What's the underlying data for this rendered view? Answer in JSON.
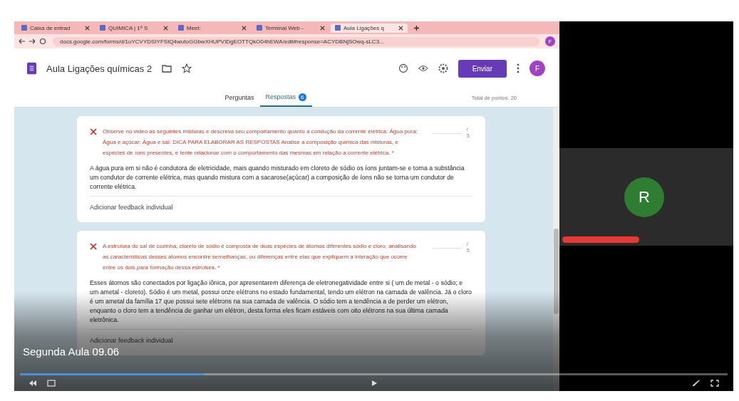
{
  "browser": {
    "tabs": [
      {
        "label": "Caixa de entrad",
        "selected": false
      },
      {
        "label": "QUIMICA | 1º S",
        "selected": false
      },
      {
        "label": "Meet: ",
        "selected": false
      },
      {
        "label": "Terminal Web -",
        "selected": false
      },
      {
        "label": "Aula Ligações q",
        "selected": true
      }
    ],
    "url": "docs.google.com/forms/d/1uYCVYDSIYFStQ4wutoGGbwXHUPVIDgEOTTQkO04hEWA/edit#response=ACYDBNjSOwq-sLC3...",
    "profile": "F"
  },
  "form": {
    "title": "Aula Ligações químicas 2",
    "send_button": "Enviar",
    "avatar": "F",
    "tabs": [
      {
        "label": "Perguntas",
        "selected": false
      },
      {
        "label": "Respostas",
        "selected": true,
        "badge": "6"
      }
    ],
    "total_points": "Total de pontos: 20",
    "questions": [
      {
        "correct": false,
        "text": "Observe no vídeo as seguintes misturas e descreva seu comportamento quanto a condução da corrente elétrica: Água pura: Água e açúcar: Água e sal: DICA PARA ELABORAR AS RESPOSTAS Analise a composição química das misturas, e espécies de íons presentes, e tente relacionar com o comportamento das mesmas em relação a corrente elétrica. *",
        "score": "/ 5",
        "answer": "A água pura em si não é condutora de eletricidade, mais quando misturado em cloreto de sódio os íons juntam-se e torna a substância um condutor de corrente elétrica, mas quando mistura com a sacarose(açúcar) a composição de íons não se torna um condutor de corrente elétrica.",
        "feedback": "Adicionar feedback individual"
      },
      {
        "correct": false,
        "text": "A estrutura do sal de cozinha, cloreto de sódio é composta de duas espécies de átomos diferentes sódio e cloro, analisando as características desses átomos encontre semelhanças, ou diferenças entre elas que expliquem a interação que ocorre entre os dois para formação dessa estrutura. *",
        "score": "/ 5",
        "answer": "Esses átomos são conectados por ligação iônica, por apresentarem diferença de eletronegatividade entre si ( um de metal - o sódio; e um ametal - cloreto). Sódio é um metal, possui onze elétrons no estado fundamental, tendo um elétron na camada de valência. Já o cloro é um ametal da família 17 que possui sete elétrons na sua camada de valência. O sódio tem a tendência a de perder um elétron, enquanto o cloro tem a tendência de ganhar um elétron, desta forma eles ficam estáveis com oito elétrons na sua última camada eletrônica.",
        "feedback": "Adicionar feedback individual"
      }
    ]
  },
  "participant": {
    "initial": "R"
  },
  "video": {
    "title": "Segunda Aula 09.06",
    "level": 0.26
  }
}
